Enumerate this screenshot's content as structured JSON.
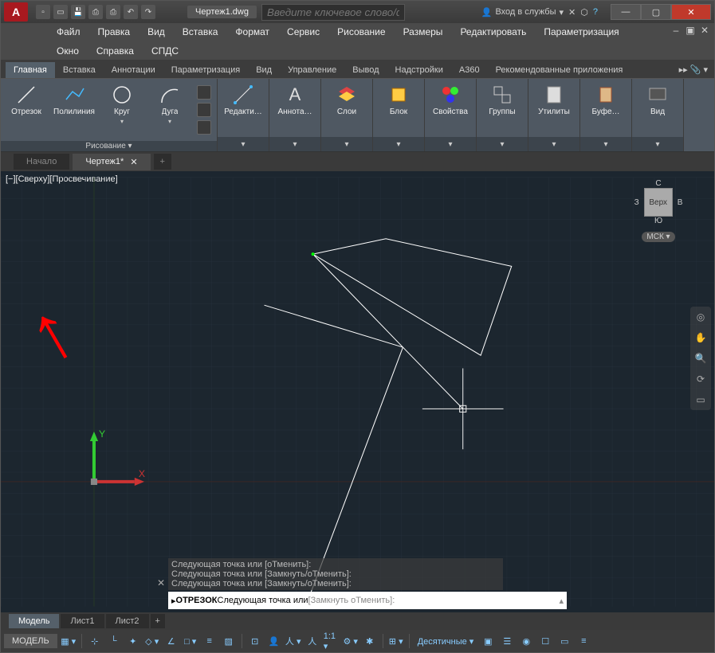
{
  "title": "Чертеж1.dwg",
  "search_placeholder": "Введите ключевое слово/фразу",
  "signin": "Вход в службы",
  "menu": [
    "Файл",
    "Правка",
    "Вид",
    "Вставка",
    "Формат",
    "Сервис",
    "Рисование",
    "Размеры",
    "Редактировать",
    "Параметризация",
    "Окно",
    "Справка",
    "СПДС"
  ],
  "ribbon_tabs": [
    "Главная",
    "Вставка",
    "Аннотации",
    "Параметризация",
    "Вид",
    "Управление",
    "Вывод",
    "Надстройки",
    "A360",
    "Рекомендованные приложения"
  ],
  "draw_panel": {
    "title": "Рисование ▾",
    "buttons": [
      {
        "label": "Отрезок"
      },
      {
        "label": "Полилиния"
      },
      {
        "label": "Круг"
      },
      {
        "label": "Дуга"
      }
    ]
  },
  "other_panels": [
    {
      "label": "Редакти…"
    },
    {
      "label": "Аннота…"
    },
    {
      "label": "Слои"
    },
    {
      "label": "Блок"
    },
    {
      "label": "Свойства"
    },
    {
      "label": "Группы"
    },
    {
      "label": "Утилиты"
    },
    {
      "label": "Буфе…"
    },
    {
      "label": "Вид"
    }
  ],
  "doc_tabs": [
    "Начало",
    "Чертеж1*"
  ],
  "viewport_label": "[−][Сверху][Просвечивание]",
  "viewcube": {
    "top": "С",
    "right": "В",
    "bottom": "Ю",
    "left": "З",
    "face": "Верх",
    "wcs": "МСК"
  },
  "command_history": [
    "Следующая точка или [оТменить]:",
    "Следующая точка или [Замкнуть/оТменить]:",
    "Следующая точка или [Замкнуть/оТменить]:"
  ],
  "command_prompt": {
    "cmd": "ОТРЕЗОК",
    "text": " Следующая точка или ",
    "opts": "[Замкнуть оТменить]:"
  },
  "bottom_tabs": [
    "Модель",
    "Лист1",
    "Лист2"
  ],
  "status": {
    "model": "МОДЕЛЬ",
    "scale": "1:1 ▾",
    "units": "Десятичные ▾"
  }
}
